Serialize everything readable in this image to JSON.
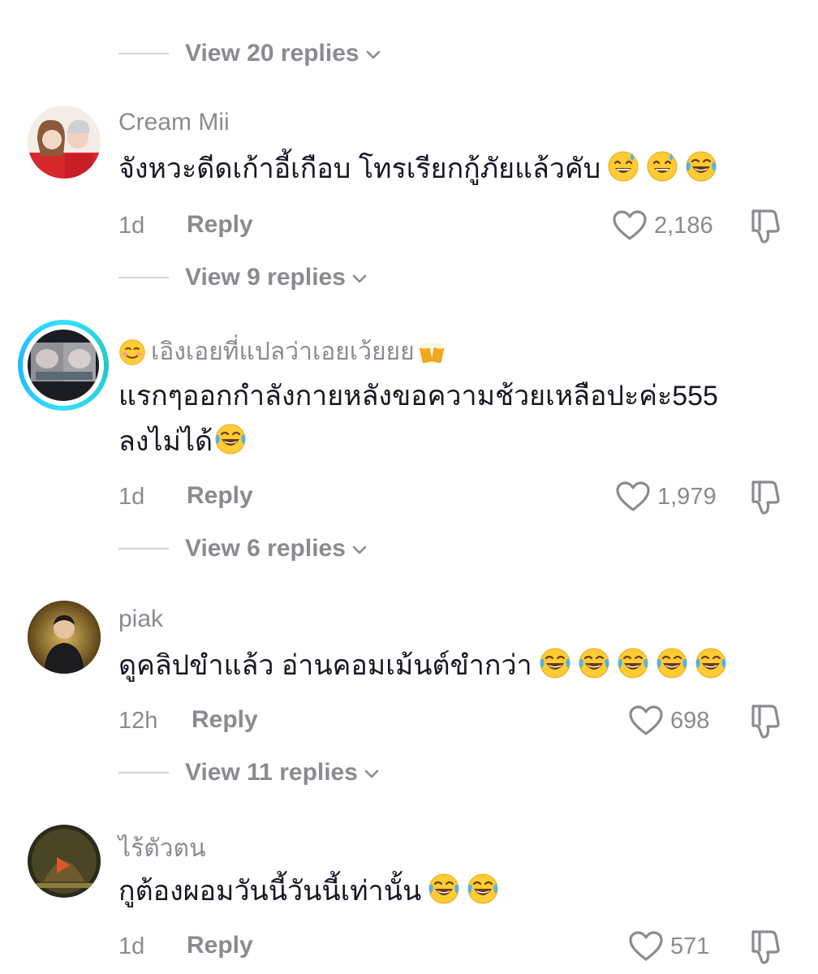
{
  "view_replies": [
    "View 20 replies",
    "View 9 replies",
    "View 6 replies",
    "View 11 replies"
  ],
  "comments": [
    {
      "username": "Cream Mii",
      "text": "จังหวะดีดเก้าอี้เกือบ โทรเรียกกู้ภัยแล้วคับ",
      "text_emojis": [
        "grinning-sweat-emoji",
        "grinning-sweat-emoji",
        "tears-of-joy-emoji"
      ],
      "time": "1d",
      "reply_label": "Reply",
      "likes": "2,186"
    },
    {
      "username": "เอิงเอยที่แปลว่าเอยเว้ยยย",
      "username_emojis": [
        "smiling-blush-emoji",
        "beer-mugs-emoji"
      ],
      "text_line1": "แรกๆออกกำลังกายหลังขอความช้วยเหลือปะค่ะ555",
      "text_line2": "ลงไม่ได้",
      "text_emojis": [
        "tears-of-joy-emoji"
      ],
      "time": "1d",
      "reply_label": "Reply",
      "likes": "1,979"
    },
    {
      "username": "piak",
      "text": "ดูคลิปขำแล้ว อ่านคอมเม้นต์ขำกว่า",
      "text_emojis": [
        "tears-of-joy-emoji",
        "tears-of-joy-emoji",
        "tears-of-joy-emoji",
        "tears-of-joy-emoji",
        "tears-of-joy-emoji"
      ],
      "time": "12h",
      "reply_label": "Reply",
      "likes": "698"
    },
    {
      "username": "ไร้ตัวตน",
      "text": "กูต้องผอมวันนี้วันนี้เท่านั้น",
      "text_emojis": [
        "tears-of-joy-emoji",
        "tears-of-joy-emoji"
      ],
      "time": "1d",
      "reply_label": "Reply",
      "likes": "571"
    }
  ],
  "colors": {
    "secondary_text": "#8a8b91",
    "primary_text": "#161823",
    "story_ring": "#35e0ff"
  },
  "icons": [
    "chevron-down-icon",
    "heart-icon",
    "thumbs-down-icon"
  ]
}
